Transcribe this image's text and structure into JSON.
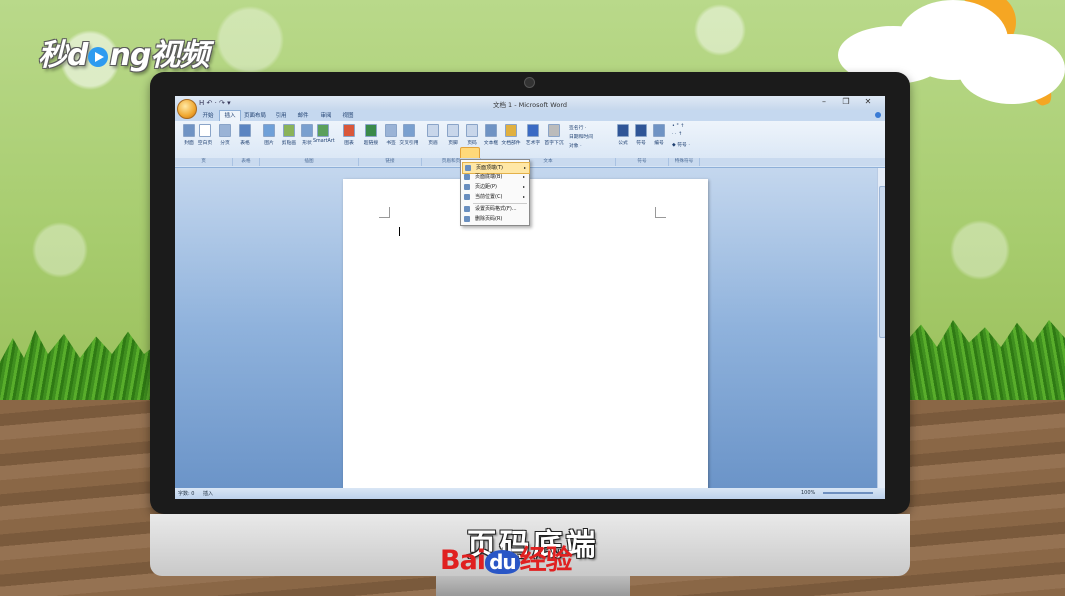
{
  "brand": {
    "logo_pre": "秒",
    "logo_mid": "d",
    "logo_post": "ng视频"
  },
  "window": {
    "title": "文档 1 - Microsoft Word",
    "qat": "H ↶ · ↷ ▾",
    "controls": [
      "–",
      "❐",
      "✕"
    ]
  },
  "tabs": [
    "开始",
    "插入",
    "页面布局",
    "引用",
    "邮件",
    "审阅",
    "视图"
  ],
  "active_tab": "插入",
  "ribbon": {
    "buttons": [
      {
        "label": "封面",
        "color": "#6f93c4"
      },
      {
        "label": "空白页",
        "color": "#ffffff"
      },
      {
        "label": "分页",
        "color": "#9ab3d6"
      },
      {
        "label": "表格",
        "color": "#5a84c2"
      },
      {
        "label": "图片",
        "color": "#6fa0d8"
      },
      {
        "label": "剪贴画",
        "color": "#8ab35a"
      },
      {
        "label": "形状",
        "color": "#7aa0cf"
      },
      {
        "label": "SmartArt",
        "color": "#5ba05b"
      },
      {
        "label": "图表",
        "color": "#d9573a"
      },
      {
        "label": "超链接",
        "color": "#3a8a4a"
      },
      {
        "label": "书签",
        "color": "#9ab3d6"
      },
      {
        "label": "交叉引用",
        "color": "#7aa0cf"
      },
      {
        "label": "页眉",
        "color": "#c8d6ea"
      },
      {
        "label": "页脚",
        "color": "#c8d6ea"
      },
      {
        "label": "页码",
        "color": "#c8d6ea"
      },
      {
        "label": "文本框",
        "color": "#6f93c4"
      },
      {
        "label": "文档部件",
        "color": "#e0b040"
      },
      {
        "label": "艺术字",
        "color": "#3a6ac4"
      },
      {
        "label": "首字下沉",
        "color": "#bbbbbb"
      },
      {
        "label": "公式",
        "color": "#2f5597"
      },
      {
        "label": "符号",
        "color": "#2f5597"
      },
      {
        "label": "编号",
        "color": "#6f93c4"
      }
    ],
    "small_buttons": [
      "签名行 ·",
      "日期和时间",
      "对象 ·"
    ],
    "special_symbols": [
      "• ° ↑",
      "· · ↑",
      "◆ 符号 ·"
    ],
    "groups": [
      "页",
      "表格",
      "插图",
      "链接",
      "页眉和页",
      "文本",
      "符号",
      "特殊符号"
    ]
  },
  "page_number_menu": {
    "items": [
      {
        "label": "页面顶端(T)",
        "has_submenu": true,
        "selected": true
      },
      {
        "label": "页面底端(B)",
        "has_submenu": true,
        "selected": false
      },
      {
        "label": "页边距(P)",
        "has_submenu": true,
        "selected": false
      },
      {
        "label": "当前位置(C)",
        "has_submenu": true,
        "selected": false
      },
      {
        "label": "设置页码格式(F)...",
        "has_submenu": false,
        "selected": false
      },
      {
        "label": "删除页码(R)",
        "has_submenu": false,
        "selected": false
      }
    ]
  },
  "status_bar": {
    "word_count": "字数: 0",
    "mode": "插入",
    "zoom": "100%"
  },
  "caption": "页码底端",
  "watermark": {
    "pre": "Bai",
    "du": "du",
    "post": "经验"
  }
}
